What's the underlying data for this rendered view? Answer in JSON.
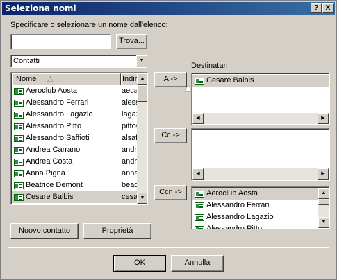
{
  "window": {
    "title": "Seleziona nomi",
    "help_label": "?",
    "close_label": "X"
  },
  "search": {
    "instruction": "Specificare o selezionare un nome dall'elenco:",
    "value": "",
    "find_label": "Trova..."
  },
  "addressbook": {
    "selected": "Contatti"
  },
  "contacts": {
    "columns": [
      "Nome",
      "Indiriz"
    ],
    "rows": [
      {
        "name": "Aeroclub Aosta",
        "email": "aeca"
      },
      {
        "name": "Alessandro Ferrari",
        "email": "aless"
      },
      {
        "name": "Alessandro Lagazio",
        "email": "lagaz"
      },
      {
        "name": "Alessandro Pitto",
        "email": "pittoC"
      },
      {
        "name": "Alessandro Saffioti",
        "email": "alsaf"
      },
      {
        "name": "Andrea Carrano",
        "email": "andre"
      },
      {
        "name": "Andrea Costa",
        "email": "andre"
      },
      {
        "name": "Anna Pigna",
        "email": "anna"
      },
      {
        "name": "Beatrice Demont",
        "email": "bead"
      },
      {
        "name": "Cesare Balbis",
        "email": "cesa"
      }
    ]
  },
  "recipients": {
    "label": "Destinatari",
    "to_button": "A ->",
    "cc_button": "Cc ->",
    "bcc_button": "Ccn ->",
    "to": [
      "Cesare Balbis"
    ],
    "bcc": [
      "Aeroclub Aosta",
      "Alessandro Ferrari",
      "Alessandro Lagazio",
      "Alessandro Pitto"
    ]
  },
  "footer": {
    "new_contact": "Nuovo contatto",
    "properties": "Proprietà",
    "ok": "OK",
    "cancel": "Annulla"
  }
}
